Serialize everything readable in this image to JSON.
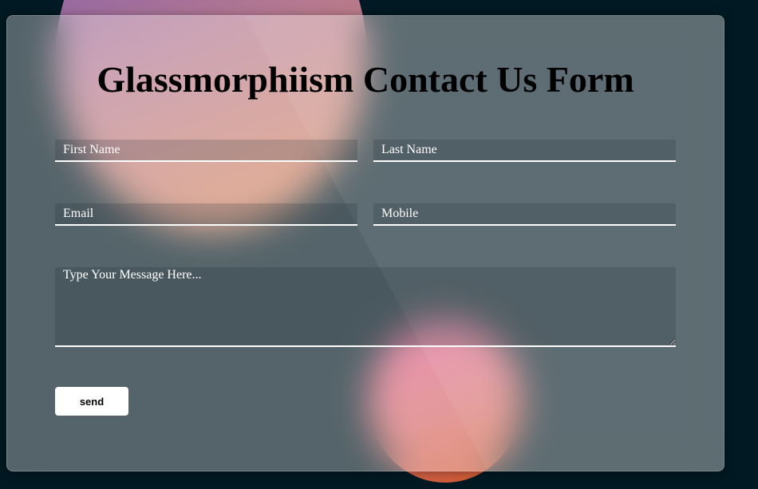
{
  "form": {
    "title": "Glassmorphiism Contact Us Form",
    "first_name_placeholder": "First Name",
    "last_name_placeholder": "Last Name",
    "email_placeholder": "Email",
    "mobile_placeholder": "Mobile",
    "message_placeholder": "Type Your Message Here...",
    "send_label": "send"
  },
  "colors": {
    "background": "#011922",
    "accent_blob_top": "#b47890",
    "accent_blob_bottom": "#e25590",
    "button_background": "#ffffff"
  }
}
